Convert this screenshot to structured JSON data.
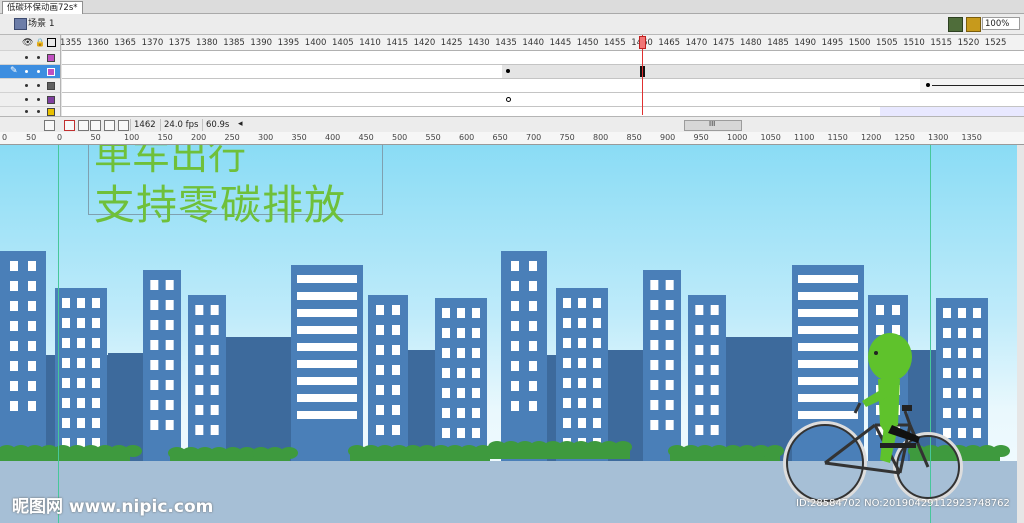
{
  "document": {
    "tab_title": "低碳环保动画72s*"
  },
  "scene_bar": {
    "scene_label": "场景 1",
    "zoom": "100%"
  },
  "timeline": {
    "frame_numbers": [
      "1355",
      "1360",
      "1365",
      "1370",
      "1375",
      "1380",
      "1385",
      "1390",
      "1395",
      "1400",
      "1405",
      "1410",
      "1415",
      "1420",
      "1425",
      "1430",
      "1435",
      "1440",
      "1445",
      "1450",
      "1455",
      "1460",
      "1465",
      "1470",
      "1475",
      "1480",
      "1485",
      "1490",
      "1495",
      "1500",
      "1505",
      "1510",
      "1515",
      "1520",
      "1525"
    ],
    "layer_colors": [
      "#c050c0",
      "#c050c0",
      "#606060",
      "#8040a0",
      "#e8c000"
    ],
    "current_frame": "1462",
    "fps": "24.0 fps",
    "elapsed": "60.9s",
    "scroll_label": "III"
  },
  "stage_ruler": {
    "labels": [
      "0",
      "50",
      "0",
      "50",
      "100",
      "150",
      "200",
      "250",
      "300",
      "350",
      "400",
      "450",
      "500",
      "550",
      "600",
      "650",
      "700",
      "750",
      "800",
      "850",
      "900",
      "950",
      "1000",
      "1050",
      "1100",
      "1150",
      "1200",
      "1250",
      "1300",
      "1350"
    ]
  },
  "stage": {
    "headline_partial": "单车出行",
    "headline": "支持零碳排放",
    "watermark": "昵图网 www.nipic.com",
    "image_id": "ID:28584702 NO:20190429112923748762",
    "colors": {
      "building": "#4a7fb8",
      "building_dark": "#3d6a9c",
      "bush": "#3e9a3e",
      "character": "#5fc22c",
      "text": "#6fc03a"
    }
  }
}
